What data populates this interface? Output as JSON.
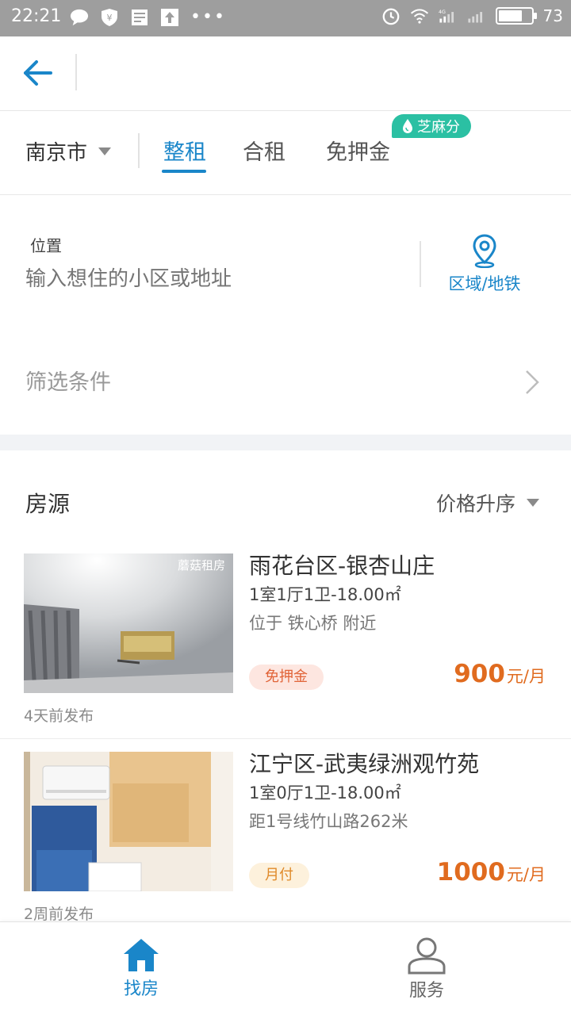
{
  "status_bar": {
    "time": "22:21",
    "battery": "73",
    "battery_fraction": 0.73,
    "icons_left": [
      "chat-bubble-icon",
      "shield-icon",
      "document-icon",
      "upload-icon",
      "more-dots-icon"
    ],
    "icons_right": [
      "alarm-icon",
      "wifi-icon",
      "signal-4g-icon",
      "signal-icon",
      "battery-icon"
    ]
  },
  "header": {
    "back_icon": "back-arrow-icon"
  },
  "tabs": {
    "city": "南京市",
    "items": [
      {
        "label": "整租",
        "active": true
      },
      {
        "label": "合租",
        "active": false
      },
      {
        "label": "免押金",
        "active": false
      }
    ],
    "badge": "芝麻分"
  },
  "search": {
    "location_label": "位置",
    "location_placeholder": "输入想住的小区或地址",
    "area_button": "区域/地铁",
    "filter_label": "筛选条件"
  },
  "listings_header": {
    "title": "房源",
    "sort_label": "价格升序"
  },
  "listings": [
    {
      "title": "雨花台区-银杏山庄",
      "layout": "1室1厅1卫-18.00㎡",
      "desc": "位于 铁心桥 附近",
      "tag": "免押金",
      "price": "900",
      "unit": "元/月",
      "time": "4天前发布",
      "watermark": "蘑菇租房"
    },
    {
      "title": "江宁区-武夷绿洲观竹苑",
      "layout": "1室0厅1卫-18.00㎡",
      "desc": "距1号线竹山路262米",
      "tag": "月付",
      "price": "1000",
      "unit": "元/月",
      "time": "2周前发布"
    }
  ],
  "bottom_nav": {
    "items": [
      {
        "label": "找房",
        "icon": "home-icon",
        "active": true
      },
      {
        "label": "服务",
        "icon": "person-icon",
        "active": false
      }
    ]
  },
  "colors": {
    "accent": "#1a86c9",
    "price": "#e06b1f",
    "badge": "#2bc0a3"
  }
}
